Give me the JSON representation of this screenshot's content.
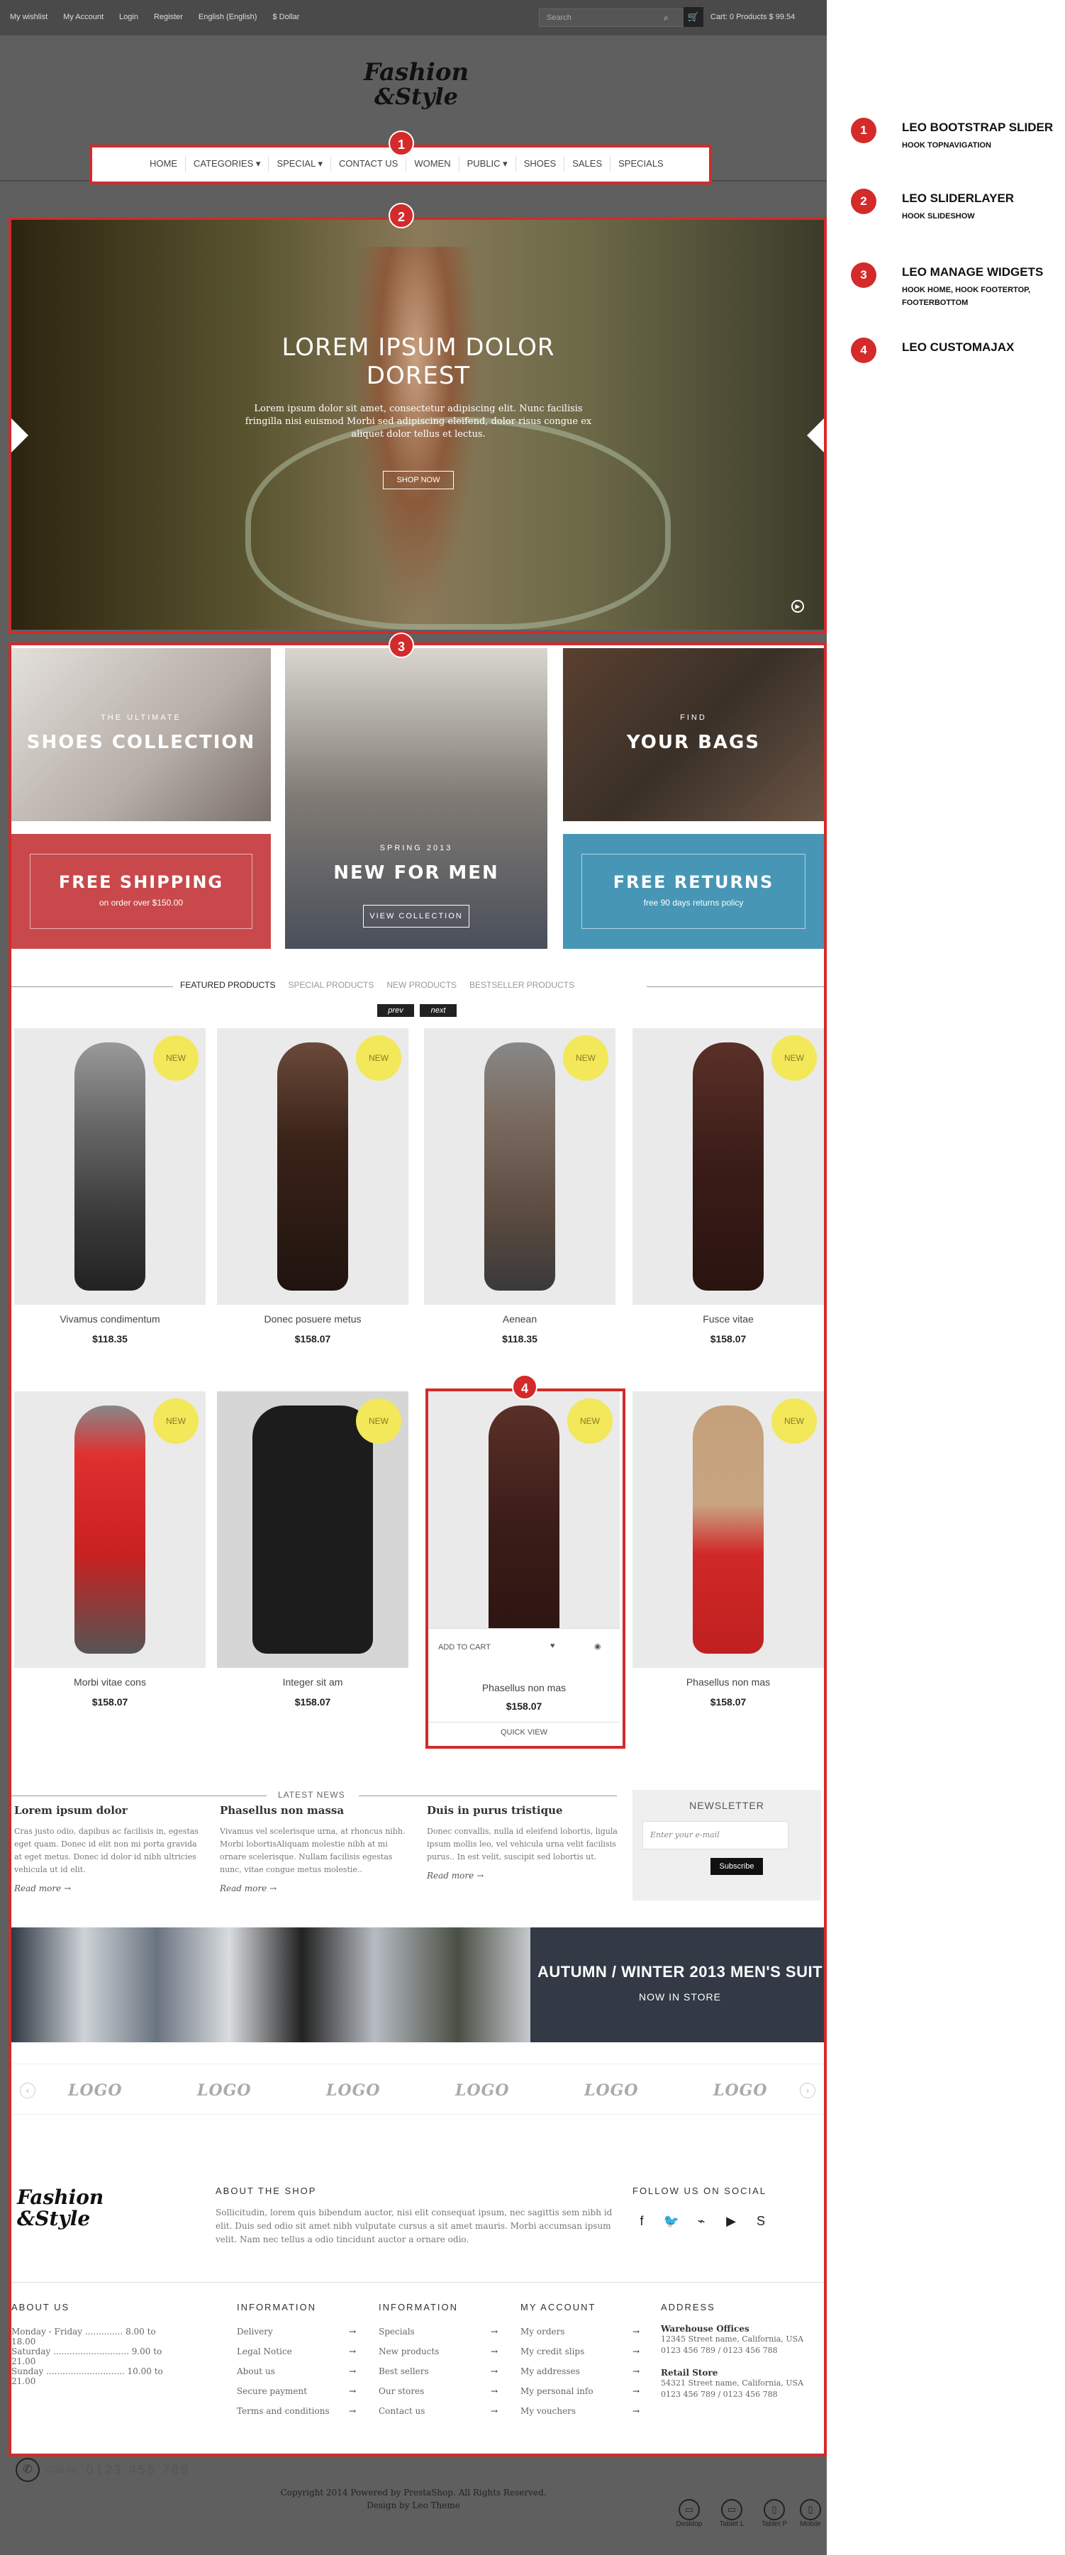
{
  "topbar": {
    "links": [
      "My wishlist",
      "My Account",
      "Login",
      "Register",
      "English (English)",
      "$ Dollar"
    ],
    "search_placeholder": "Search",
    "cart_text": "Cart: 0 Products $ 99.54"
  },
  "logo": {
    "line1": "Fashion",
    "line2": "&Style"
  },
  "nav": {
    "items": [
      "HOME",
      "CATEGORIES ▾",
      "SPECIAL ▾",
      "CONTACT US",
      "WOMEN",
      "PUBLIC ▾",
      "SHOES",
      "SALES",
      "SPECIALS"
    ]
  },
  "badges": [
    "1",
    "2",
    "3",
    "4"
  ],
  "slider": {
    "title": "LOREM IPSUM DOLOR DOREST",
    "text": "Lorem ipsum dolor sit amet, consectetur adipiscing elit. Nunc facilisis fringilla nisi euismod Morbi sed adipiscing eleifend, dolor risus congue ex aliquet dolor tellus et lectus.",
    "button": "SHOP NOW"
  },
  "banners": {
    "shoes": {
      "small": "THE ULTIMATE",
      "big": "SHOES COLLECTION"
    },
    "men": {
      "small": "SPRING 2013",
      "big": "NEW FOR MEN",
      "button": "VIEW COLLECTION"
    },
    "bags": {
      "small": "FIND",
      "big": "YOUR BAGS"
    },
    "shipping": {
      "big": "FREE SHIPPING",
      "small": "on order over $150.00"
    },
    "returns": {
      "big": "FREE RETURNS",
      "small": "free 90 days returns policy"
    }
  },
  "tabs": [
    "FEATURED PRODUCTS",
    "SPECIAL PRODUCTS",
    "NEW PRODUCTS",
    "BESTSELLER PRODUCTS"
  ],
  "pager": {
    "prev": "prev",
    "next": "next"
  },
  "new_label": "NEW",
  "products": [
    {
      "name": "Vivamus condimentum",
      "price": "$118.35"
    },
    {
      "name": "Donec posuere metus",
      "price": "$158.07"
    },
    {
      "name": "Aenean",
      "price": "$118.35"
    },
    {
      "name": "Fusce vitae",
      "price": "$158.07"
    },
    {
      "name": "Morbi vitae cons",
      "price": "$158.07"
    },
    {
      "name": "Integer sit am",
      "price": "$158.07"
    },
    {
      "name": "Phasellus non mas",
      "price": "$158.07"
    },
    {
      "name": "Phasellus non mas",
      "price": "$158.07"
    }
  ],
  "product_hover": {
    "add_to_cart": "ADD TO CART",
    "quick_view": "QUICK VIEW"
  },
  "news": {
    "heading": "LATEST NEWS",
    "items": [
      {
        "title": "Lorem ipsum dolor",
        "text": "Cras justo odio, dapibus ac facilisis in, egestas eget quam. Donec id elit non mi porta gravida at eget metus. Donec id dolor id nibh ultricies vehicula ut id elit.",
        "more": "Read more"
      },
      {
        "title": "Phasellus non massa",
        "text": "Vivamus vel scelerisque urna, at rhoncus nibh. Morbi lobortisAliquam molestie nibh at mi ornare scelerisque. Nullam facilisis egestas nunc, vitae congue metus molestie..",
        "more": "Read more"
      },
      {
        "title": "Duis in purus tristique",
        "text": "Donec convallis, nulla id eleifend lobortis, ligula ipsum mollis leo, vel vehicula urna velit facilisis purus.. In est velit, suscipit sed lobortis ut.",
        "more": "Read more"
      }
    ]
  },
  "newsletter": {
    "heading": "NEWSLETTER",
    "placeholder": "Enter your e-mail",
    "button": "Subscribe"
  },
  "suit": {
    "title": "AUTUMN / WINTER 2013 MEN'S SUIT",
    "subtitle": "NOW IN STORE"
  },
  "logo_text": "LOGO",
  "footer": {
    "about_heading": "ABOUT THE SHOP",
    "about_text": "Sollicitudin, lorem quis bibendum auctor, nisi elit consequat ipsum, nec sagittis sem nibh id elit. Duis sed odio sit amet nibh vulputate cursus a sit amet mauris. Morbi accumsan ipsum velit. Nam nec tellus a odio tincidunt auctor a ornare odio.",
    "social_heading": "FOLLOW US ON SOCIAL",
    "about_us": {
      "heading": "ABOUT US",
      "rows": [
        "Monday - Friday .............. 8.00 to 18.00",
        "Saturday ............................ 9.00 to 21.00",
        "Sunday ............................. 10.00 to 21.00"
      ]
    },
    "information1": {
      "heading": "INFORMATION",
      "items": [
        "Delivery",
        "Legal Notice",
        "About us",
        "Secure payment",
        "Terms and conditions"
      ]
    },
    "information2": {
      "heading": "INFORMATION",
      "items": [
        "Specials",
        "New products",
        "Best sellers",
        "Our stores",
        "Contact us"
      ]
    },
    "account": {
      "heading": "MY ACCOUNT",
      "items": [
        "My orders",
        "My credit slips",
        "My addresses",
        "My personal info",
        "My vouchers"
      ]
    },
    "address": {
      "heading": "ADDRESS",
      "warehouse_title": "Warehouse Offices",
      "warehouse_lines": [
        "12345 Street name, California, USA",
        "0123 456 789 / 0123 456 788"
      ],
      "retail_title": "Retail Store",
      "retail_lines": [
        "54321 Street name, California, USA",
        "0123 456 789 / 0123 456 788"
      ]
    },
    "call_label": "Call us:",
    "call_number": "0123 456 789"
  },
  "copyright": {
    "line1": "Copyright 2014 Powered by PrestaShop. All Rights Reserved.",
    "line2": "Design by Leo Theme"
  },
  "devices": [
    "Desktop",
    "Tablet L",
    "Tablet P",
    "Mobile"
  ],
  "legend": [
    {
      "num": "1",
      "title": "LEO BOOTSTRAP SLIDER",
      "sub": "HOOK TOPNAVIGATION"
    },
    {
      "num": "2",
      "title": "LEO SLIDERLAYER",
      "sub": "HOOK SLIDESHOW"
    },
    {
      "num": "3",
      "title": "LEO MANAGE WIDGETS",
      "sub": "HOOK HOME, HOOK FOOTERTOP, FOOTERBOTTOM"
    },
    {
      "num": "4",
      "title": "LEO CUSTOMAJAX",
      "sub": ""
    }
  ]
}
